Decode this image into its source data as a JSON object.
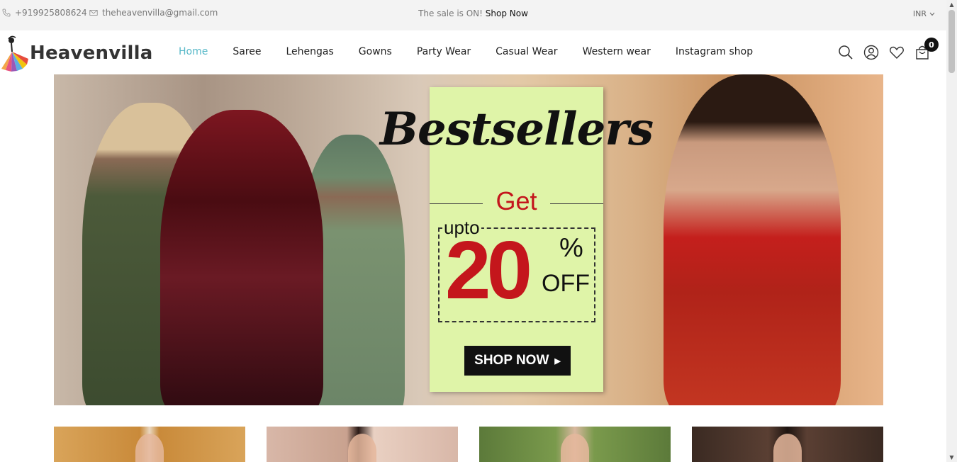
{
  "topbar": {
    "phone": "+919925808624",
    "email": "theheavenvilla@gmail.com",
    "sale_text": "The sale is ON!",
    "sale_link": "Shop Now",
    "currency": "INR"
  },
  "header": {
    "logo_text": "Heavenvilla",
    "nav": [
      "Home",
      "Saree",
      "Lehengas",
      "Gowns",
      "Party Wear",
      "Casual Wear",
      "Western wear",
      "Instagram shop"
    ],
    "active_nav": "Home",
    "cart_count": "0",
    "icons": [
      "search-icon",
      "user-icon",
      "heart-icon",
      "bag-icon"
    ]
  },
  "hero": {
    "title": "Bestsellers",
    "get": "Get",
    "upto": "upto",
    "number": "20",
    "percent": "%",
    "off": "OFF",
    "cta": "SHOP NOW"
  },
  "colors": {
    "accent": "#57b8c8",
    "promo_bg": "#dff4a8",
    "promo_red": "#c4161c",
    "topbar_bg": "#f3f3f3"
  }
}
